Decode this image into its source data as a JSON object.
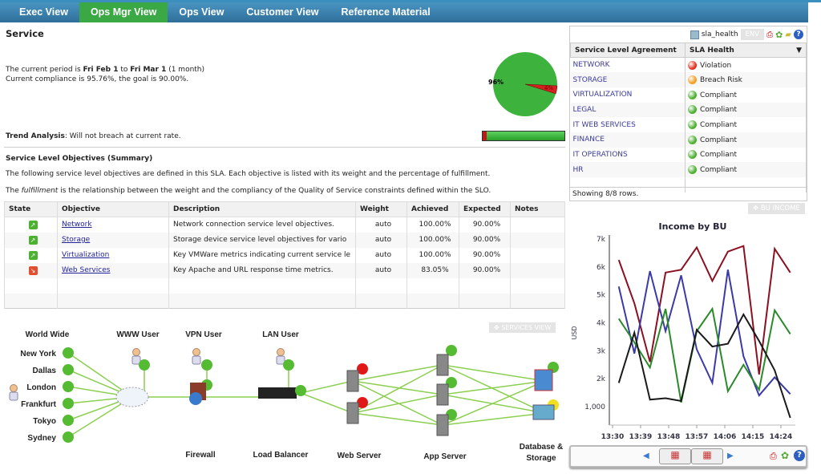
{
  "nav": {
    "tabs": [
      "Exec View",
      "Ops Mgr View",
      "Ops View",
      "Customer View",
      "Reference Material"
    ],
    "active": 1
  },
  "service": {
    "title": "Service",
    "period_prefix": "The current period is ",
    "period_start": "Fri Feb 1",
    "period_mid": " to ",
    "period_end": "Fri Mar 1",
    "period_suffix": " (1 month)",
    "compliance": "Current compliance is 95.76%, the goal is 90.00%.",
    "pie": {
      "compliant_pct": 96,
      "violation_pct": 4,
      "label_main": "96%",
      "label_small": "4%",
      "colors": {
        "compliant": "#3db33d",
        "violation": "#d42020"
      }
    },
    "trend_label": "Trend Analysis",
    "trend_text": ": Will not breach at current rate.",
    "trend_bar": {
      "red_fraction": 0.05
    }
  },
  "slo": {
    "heading": "Service Level Objectives (Summary)",
    "intro": "The following service level objectives are defined in this SLA. Each objective is listed with its weight and the percentage of fulfillment.",
    "fulfill_pre": "The ",
    "fulfill_em": "fulfillment",
    "fulfill_post": " is the relationship between the weight and the compliancy of the Quality of Service constraints defined within the SLO.",
    "columns": [
      "State",
      "Objective",
      "Description",
      "Weight",
      "Achieved",
      "Expected",
      "Notes"
    ],
    "rows": [
      {
        "state": "up",
        "objective": "Network",
        "description": "Network connection service level objectives.",
        "weight": "auto",
        "achieved": "100.00%",
        "expected": "90.00%",
        "notes": ""
      },
      {
        "state": "up",
        "objective": "Storage",
        "description": "Storage device service level objectives for vario",
        "weight": "auto",
        "achieved": "100.00%",
        "expected": "90.00%",
        "notes": ""
      },
      {
        "state": "up",
        "objective": "Virtualization",
        "description": "Key VMWare metrics indicating current service le",
        "weight": "auto",
        "achieved": "100.00%",
        "expected": "90.00%",
        "notes": ""
      },
      {
        "state": "down",
        "objective": "Web Services",
        "description": "Key Apache and URL response time metrics.",
        "weight": "auto",
        "achieved": "83.05%",
        "expected": "90.00%",
        "notes": ""
      }
    ]
  },
  "sla_panel": {
    "name": "sla_health",
    "ghost": "ENV",
    "col1": "Service Level Agreement",
    "col2": "SLA Health",
    "rows": [
      {
        "bu": "NETWORK",
        "status": "Violation",
        "color": "#e33020"
      },
      {
        "bu": "STORAGE",
        "status": "Breach Risk",
        "color": "#f2a020"
      },
      {
        "bu": "VIRTUALIZATION",
        "status": "Compliant",
        "color": "#4cb030"
      },
      {
        "bu": "LEGAL",
        "status": "Compliant",
        "color": "#4cb030"
      },
      {
        "bu": "IT WEB SERVICES",
        "status": "Compliant",
        "color": "#4cb030"
      },
      {
        "bu": "FINANCE",
        "status": "Compliant",
        "color": "#4cb030"
      },
      {
        "bu": "IT OPERATIONS",
        "status": "Compliant",
        "color": "#4cb030"
      },
      {
        "bu": "HR",
        "status": "Compliant",
        "color": "#4cb030"
      }
    ],
    "footer": "Showing 8/8 rows.",
    "bu_income_button": "BU INCOME"
  },
  "services_view_button": "SERVICES VIEW",
  "diagram": {
    "headers": {
      "world": "World Wide",
      "www": "WWW User",
      "vpn": "VPN User",
      "lan": "LAN User"
    },
    "cities": [
      "New York",
      "Dallas",
      "London",
      "Frankfurt",
      "Tokyo",
      "Sydney"
    ],
    "tiers": {
      "firewall": "Firewall",
      "lb": "Load Balancer",
      "web": "Web Server",
      "app": "App Server",
      "db1": "Database &",
      "db2": "Storage"
    },
    "status_colors": {
      "ok": "#55bb33",
      "error": "#e01818",
      "warn": "#f0e020"
    }
  },
  "chart_data": {
    "type": "line",
    "title": "Income by BU",
    "ylabel": "USD",
    "x": [
      "13:32",
      "13:37",
      "13:42",
      "13:47",
      "13:52",
      "13:57",
      "14:02",
      "14:07",
      "14:12",
      "14:17",
      "14:22",
      "14:27"
    ],
    "xticks": [
      "13:30",
      "13:39",
      "13:48",
      "13:57",
      "14:06",
      "14:15",
      "14:24"
    ],
    "yticks": [
      "1,000",
      "2k",
      "3k",
      "4k",
      "5k",
      "6k",
      "7k"
    ],
    "ylim": [
      770,
      7000
    ],
    "series": [
      {
        "color": "#8b1020",
        "values": [
          6250,
          4700,
          2600,
          5800,
          5900,
          6700,
          5500,
          6550,
          6750,
          2150,
          6650,
          5800
        ]
      },
      {
        "color": "#3a3aa8",
        "values": [
          5300,
          2900,
          5850,
          3700,
          5700,
          3050,
          1850,
          5900,
          2800,
          1400,
          2050,
          1450
        ]
      },
      {
        "color": "#2a8a2a",
        "values": [
          4150,
          3300,
          2400,
          4500,
          1150,
          3700,
          4500,
          1550,
          2500,
          1600,
          4450,
          3600
        ]
      },
      {
        "color": "#1a1a1a",
        "values": [
          1850,
          3650,
          1250,
          1300,
          1200,
          3750,
          3150,
          3250,
          4300,
          3350,
          2300,
          600
        ]
      }
    ]
  }
}
